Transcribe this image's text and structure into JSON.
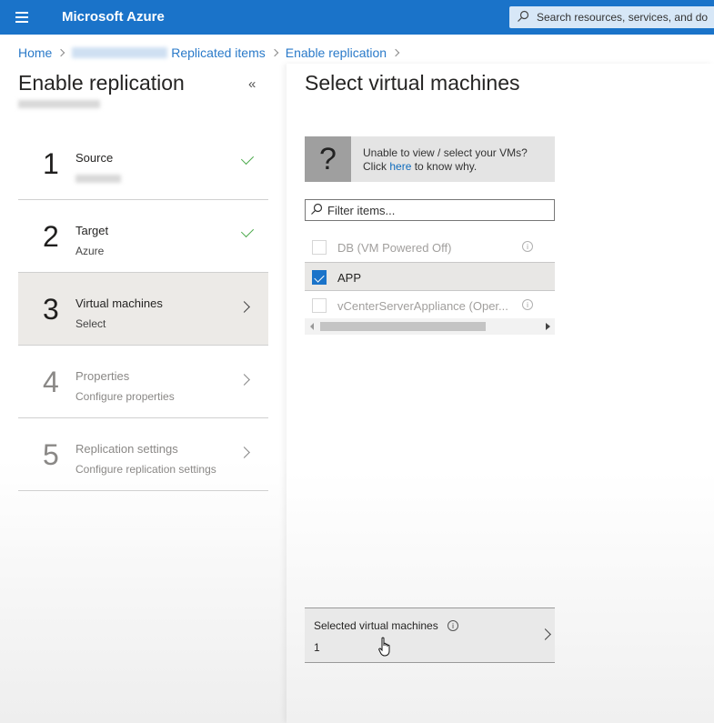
{
  "topbar": {
    "brand": "Microsoft Azure",
    "search_placeholder": "Search resources, services, and do"
  },
  "breadcrumb": {
    "home": "Home",
    "replicated_items": "Replicated items",
    "enable_replication": "Enable replication"
  },
  "left": {
    "title": "Enable replication",
    "collapse_glyph": "«",
    "steps": [
      {
        "num": "1",
        "title": "Source",
        "subtitle": "",
        "status": "done"
      },
      {
        "num": "2",
        "title": "Target",
        "subtitle": "Azure",
        "status": "done"
      },
      {
        "num": "3",
        "title": "Virtual machines",
        "subtitle": "Select",
        "status": "active"
      },
      {
        "num": "4",
        "title": "Properties",
        "subtitle": "Configure properties",
        "status": "pending"
      },
      {
        "num": "5",
        "title": "Replication settings",
        "subtitle": "Configure replication settings",
        "status": "pending"
      }
    ]
  },
  "right": {
    "title": "Select virtual machines",
    "info": {
      "glyph": "?",
      "line1": "Unable to view / select your VMs?",
      "line2_prefix": "Click ",
      "line2_link": "here",
      "line2_suffix": " to know why."
    },
    "filter_placeholder": "Filter items...",
    "vms": [
      {
        "name": "DB (VM Powered Off)",
        "checked": false,
        "enabled": false
      },
      {
        "name": "APP",
        "checked": true,
        "enabled": true
      },
      {
        "name": "vCenterServerAppliance (Oper...",
        "checked": false,
        "enabled": false
      }
    ],
    "selected_summary": {
      "label": "Selected virtual machines",
      "count": "1"
    }
  },
  "colors": {
    "topbar": "#1a73c9",
    "link": "#0f6cbd",
    "check_green": "#4caa4c",
    "checkbox_blue": "#1a73c9"
  }
}
